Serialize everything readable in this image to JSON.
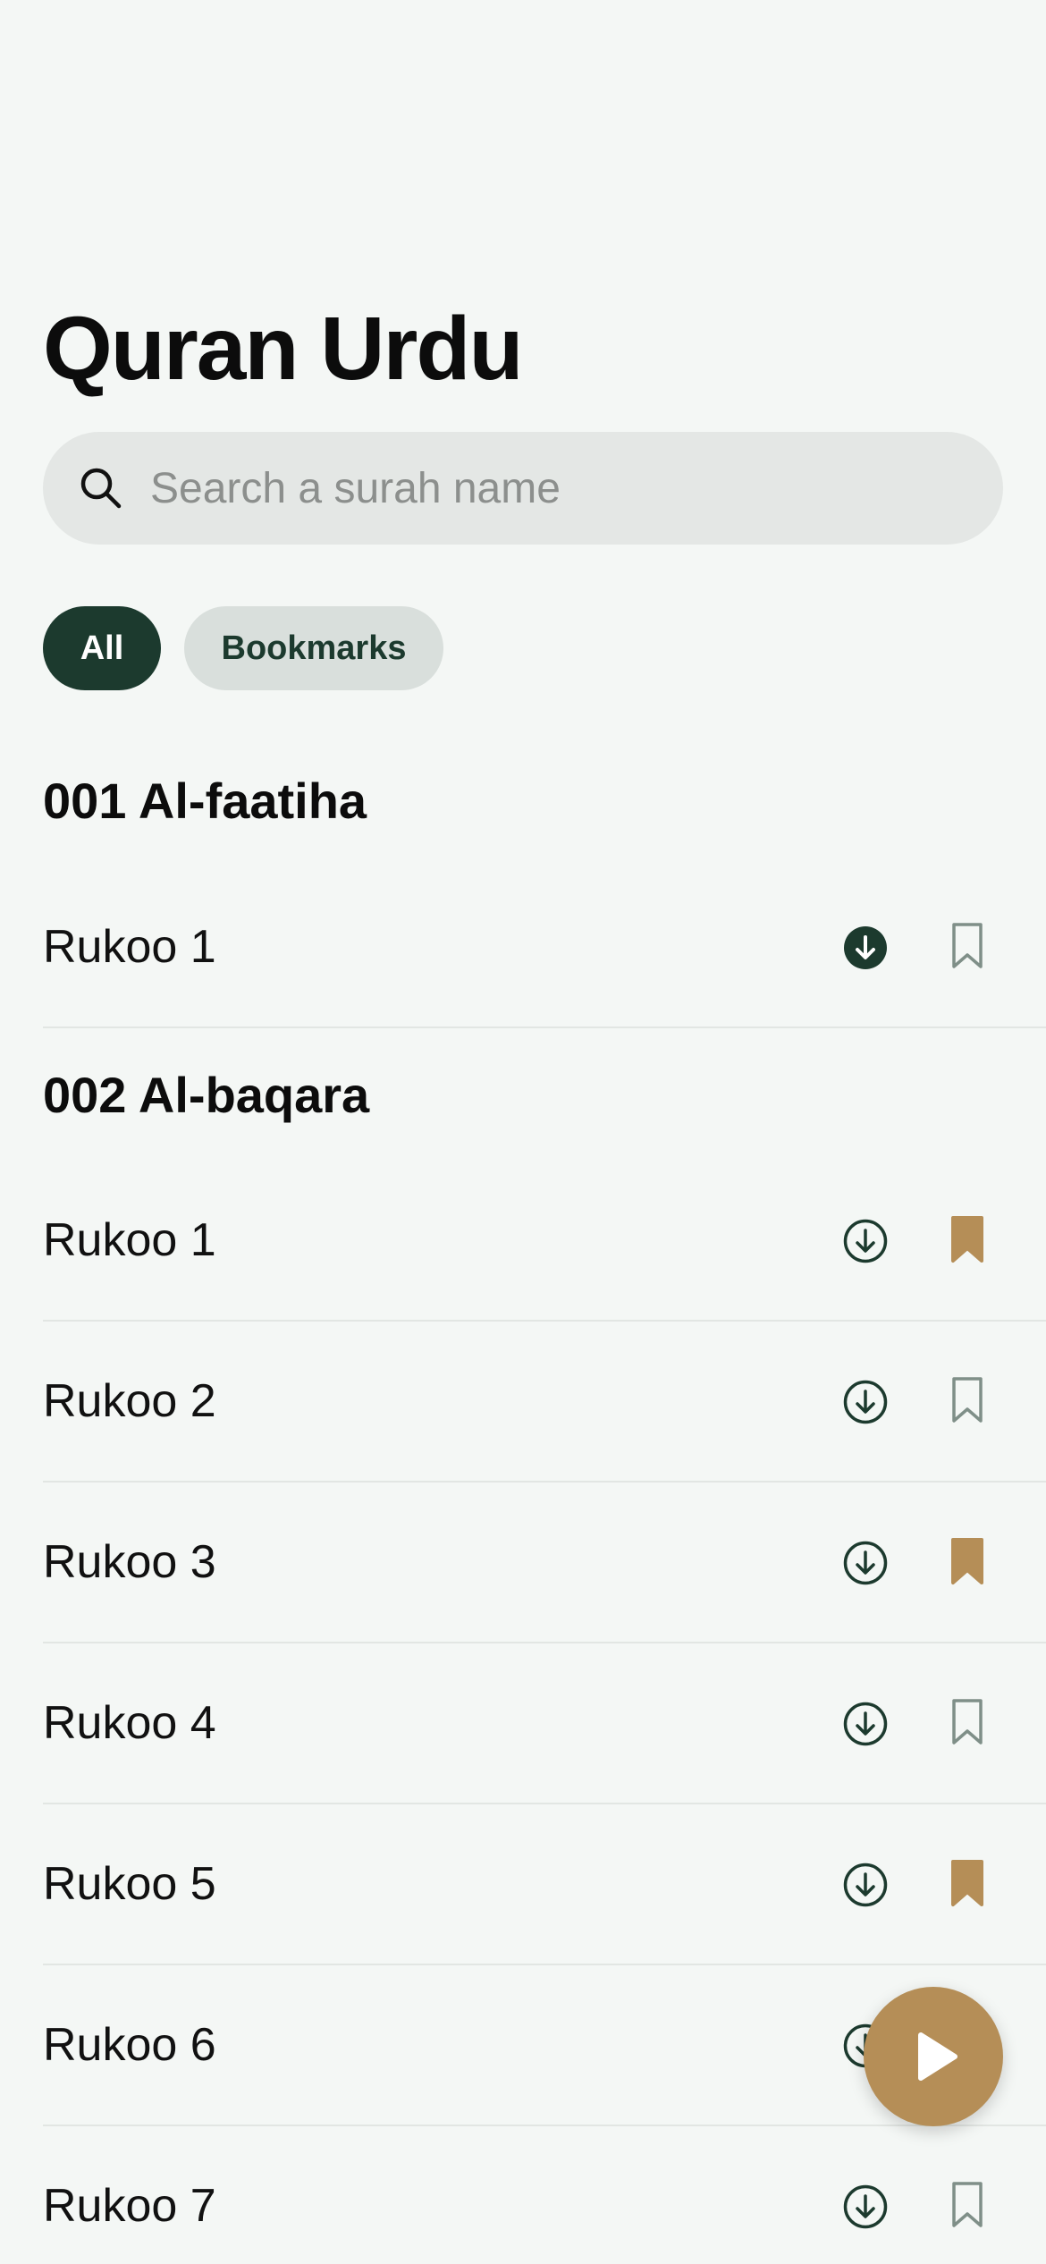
{
  "header": {
    "title": "Quran Urdu"
  },
  "search": {
    "placeholder": "Search a surah name",
    "value": ""
  },
  "filters": [
    {
      "label": "All",
      "active": true
    },
    {
      "label": "Bookmarks",
      "active": false
    }
  ],
  "colors": {
    "primary": "#1c3a2e",
    "accent": "#b58e57",
    "background": "#f4f7f5",
    "bookmark_inactive": "#7f8f88"
  },
  "surahs": [
    {
      "title": "001 Al-faatiha",
      "rukoos": [
        {
          "label": "Rukoo 1",
          "downloaded": true,
          "bookmarked": false
        }
      ]
    },
    {
      "title": "002 Al-baqara",
      "rukoos": [
        {
          "label": "Rukoo 1",
          "downloaded": false,
          "bookmarked": true
        },
        {
          "label": "Rukoo 2",
          "downloaded": false,
          "bookmarked": false
        },
        {
          "label": "Rukoo 3",
          "downloaded": false,
          "bookmarked": true
        },
        {
          "label": "Rukoo 4",
          "downloaded": false,
          "bookmarked": false
        },
        {
          "label": "Rukoo 5",
          "downloaded": false,
          "bookmarked": true
        },
        {
          "label": "Rukoo 6",
          "downloaded": false,
          "bookmarked": false
        },
        {
          "label": "Rukoo 7",
          "downloaded": false,
          "bookmarked": false
        }
      ]
    }
  ],
  "icons": {
    "search": "search-icon",
    "download": "download-icon",
    "downloaded": "downloaded-icon",
    "bookmark": "bookmark-icon",
    "bookmark_filled": "bookmark-filled-icon",
    "play": "play-icon"
  }
}
